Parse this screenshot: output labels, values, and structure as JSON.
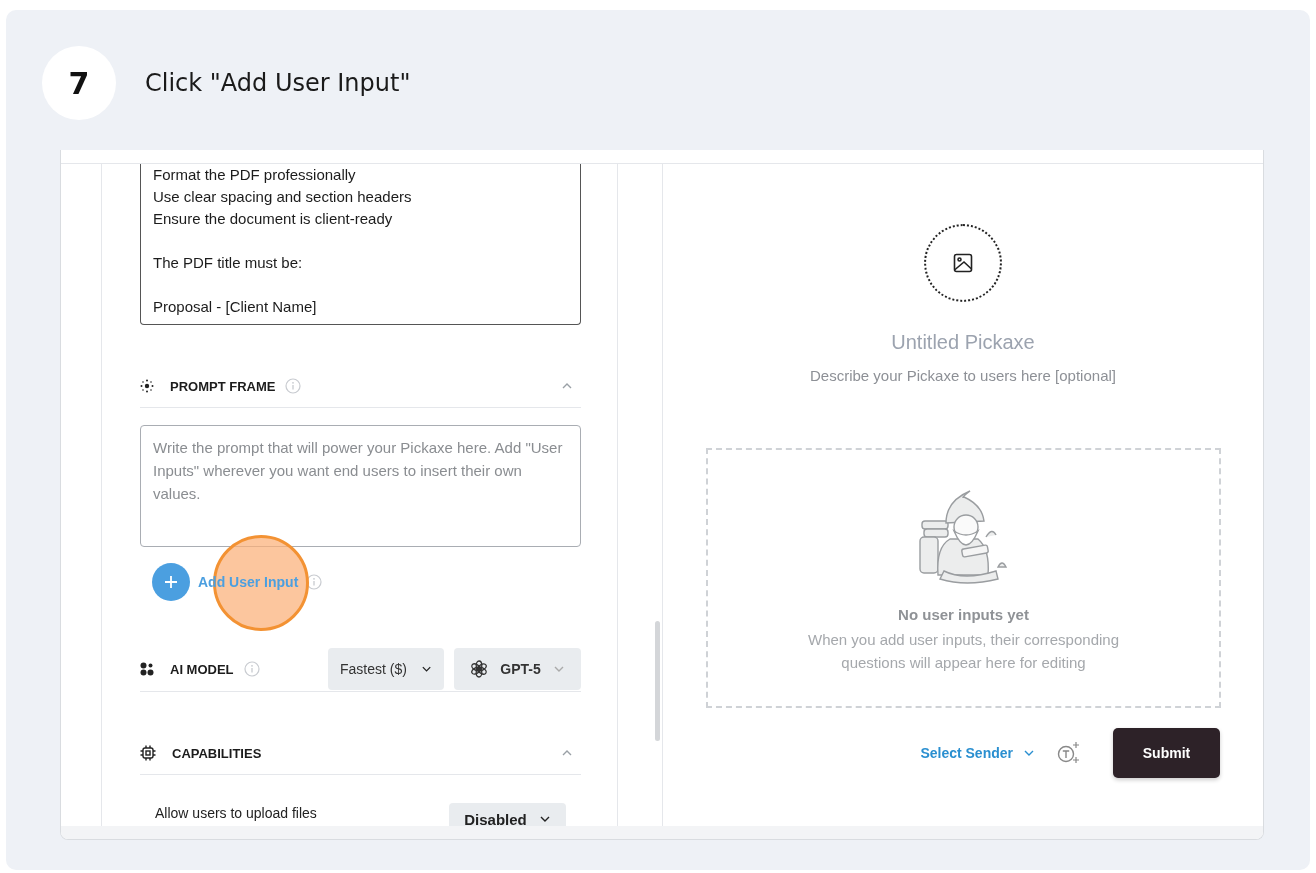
{
  "step": {
    "number": "7",
    "instruction": "Click \"Add User Input\""
  },
  "builder": {
    "instructions_value": "Format the PDF professionally\nUse clear spacing and section headers\nEnsure the document is client-ready\n\nThe PDF title must be:\n\nProposal - [Client Name]",
    "prompt_frame": {
      "title": "PROMPT FRAME",
      "expanded": true,
      "placeholder": "Write the prompt that will power your Pickaxe here. Add \"User Inputs\" wherever you want end users to insert their own values."
    },
    "add_input_label": "Add User Input",
    "ai_model": {
      "title": "AI MODEL",
      "speed": "Fastest ($)",
      "model": "GPT-5"
    },
    "capabilities": {
      "title": "CAPABILITIES",
      "expanded": true,
      "items": [
        {
          "label": "Allow users to upload files",
          "value": "Disabled"
        }
      ]
    }
  },
  "preview": {
    "title": "Untitled Pickaxe",
    "description": "Describe your Pickaxe to users here [optional]",
    "empty_title": "No user inputs yet",
    "empty_text": "When you add user inputs, their corresponding questions will appear here for editing",
    "sender": "Select Sender",
    "submit": "Submit"
  }
}
